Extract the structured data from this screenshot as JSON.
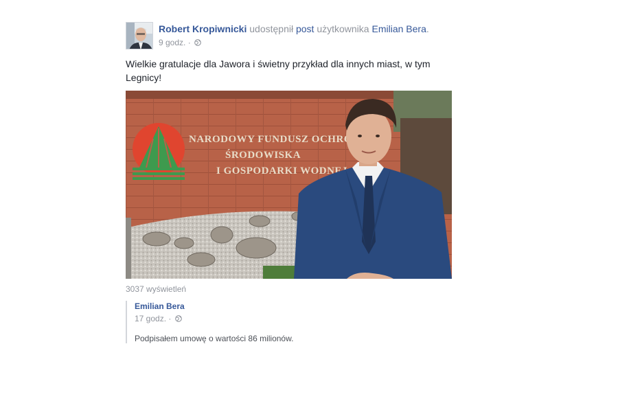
{
  "post": {
    "author_name": "Robert Kropiwnicki",
    "action_text": "udostępnił",
    "post_link": "post",
    "owner_prefix": "użytkownika",
    "owner_name": "Emilian Bera",
    "owner_suffix": ".",
    "timestamp": "9 godz.",
    "separator": "·",
    "message": "Wielkie gratulacje dla Jawora i świetny przykład dla innych miast, w tym Legnicy!",
    "video": {
      "sign_lines": [
        "NARODOWY FUNDUSZ OCHRONY",
        "ŚRODOWISKA",
        "I GOSPODARKI WODNEJ"
      ]
    },
    "views": "3037 wyświetleń"
  },
  "shared": {
    "author_name": "Emilian Bera",
    "timestamp": "17 godz.",
    "separator": "·",
    "text": "Podpisałem umowę o wartości 86 milionów."
  },
  "icons": {
    "privacy": "globe-icon",
    "avatar": "profile-photo"
  },
  "colors": {
    "link": "#365899",
    "muted": "#90949c",
    "text": "#1d2129"
  }
}
